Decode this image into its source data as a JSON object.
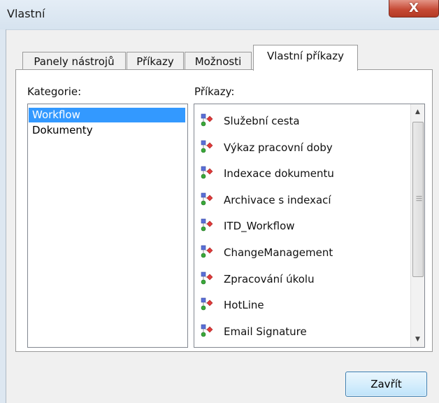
{
  "window": {
    "title": "Vlastní",
    "close_glyph": "X"
  },
  "tabs": [
    {
      "label": "Panely nástrojů"
    },
    {
      "label": "Příkazy"
    },
    {
      "label": "Možnosti"
    },
    {
      "label": "Vlastní příkazy",
      "active": true
    }
  ],
  "categories": {
    "label": "Kategorie:",
    "items": [
      "Workflow",
      "Dokumenty"
    ],
    "selected": "Workflow"
  },
  "commands": {
    "label": "Příkazy:",
    "items": [
      "Služební cesta",
      "Výkaz pracovní doby",
      "Indexace dokumentu",
      "Archivace s indexací",
      "ITD_Workflow",
      "ChangeManagement",
      "Zpracování úkolu",
      "HotLine",
      "Email Signature"
    ],
    "item_icon": "workflow-command-icon"
  },
  "footer": {
    "close_label": "Zavřít"
  },
  "colors": {
    "selection": "#3399ff",
    "close_button": "#c64a35"
  }
}
